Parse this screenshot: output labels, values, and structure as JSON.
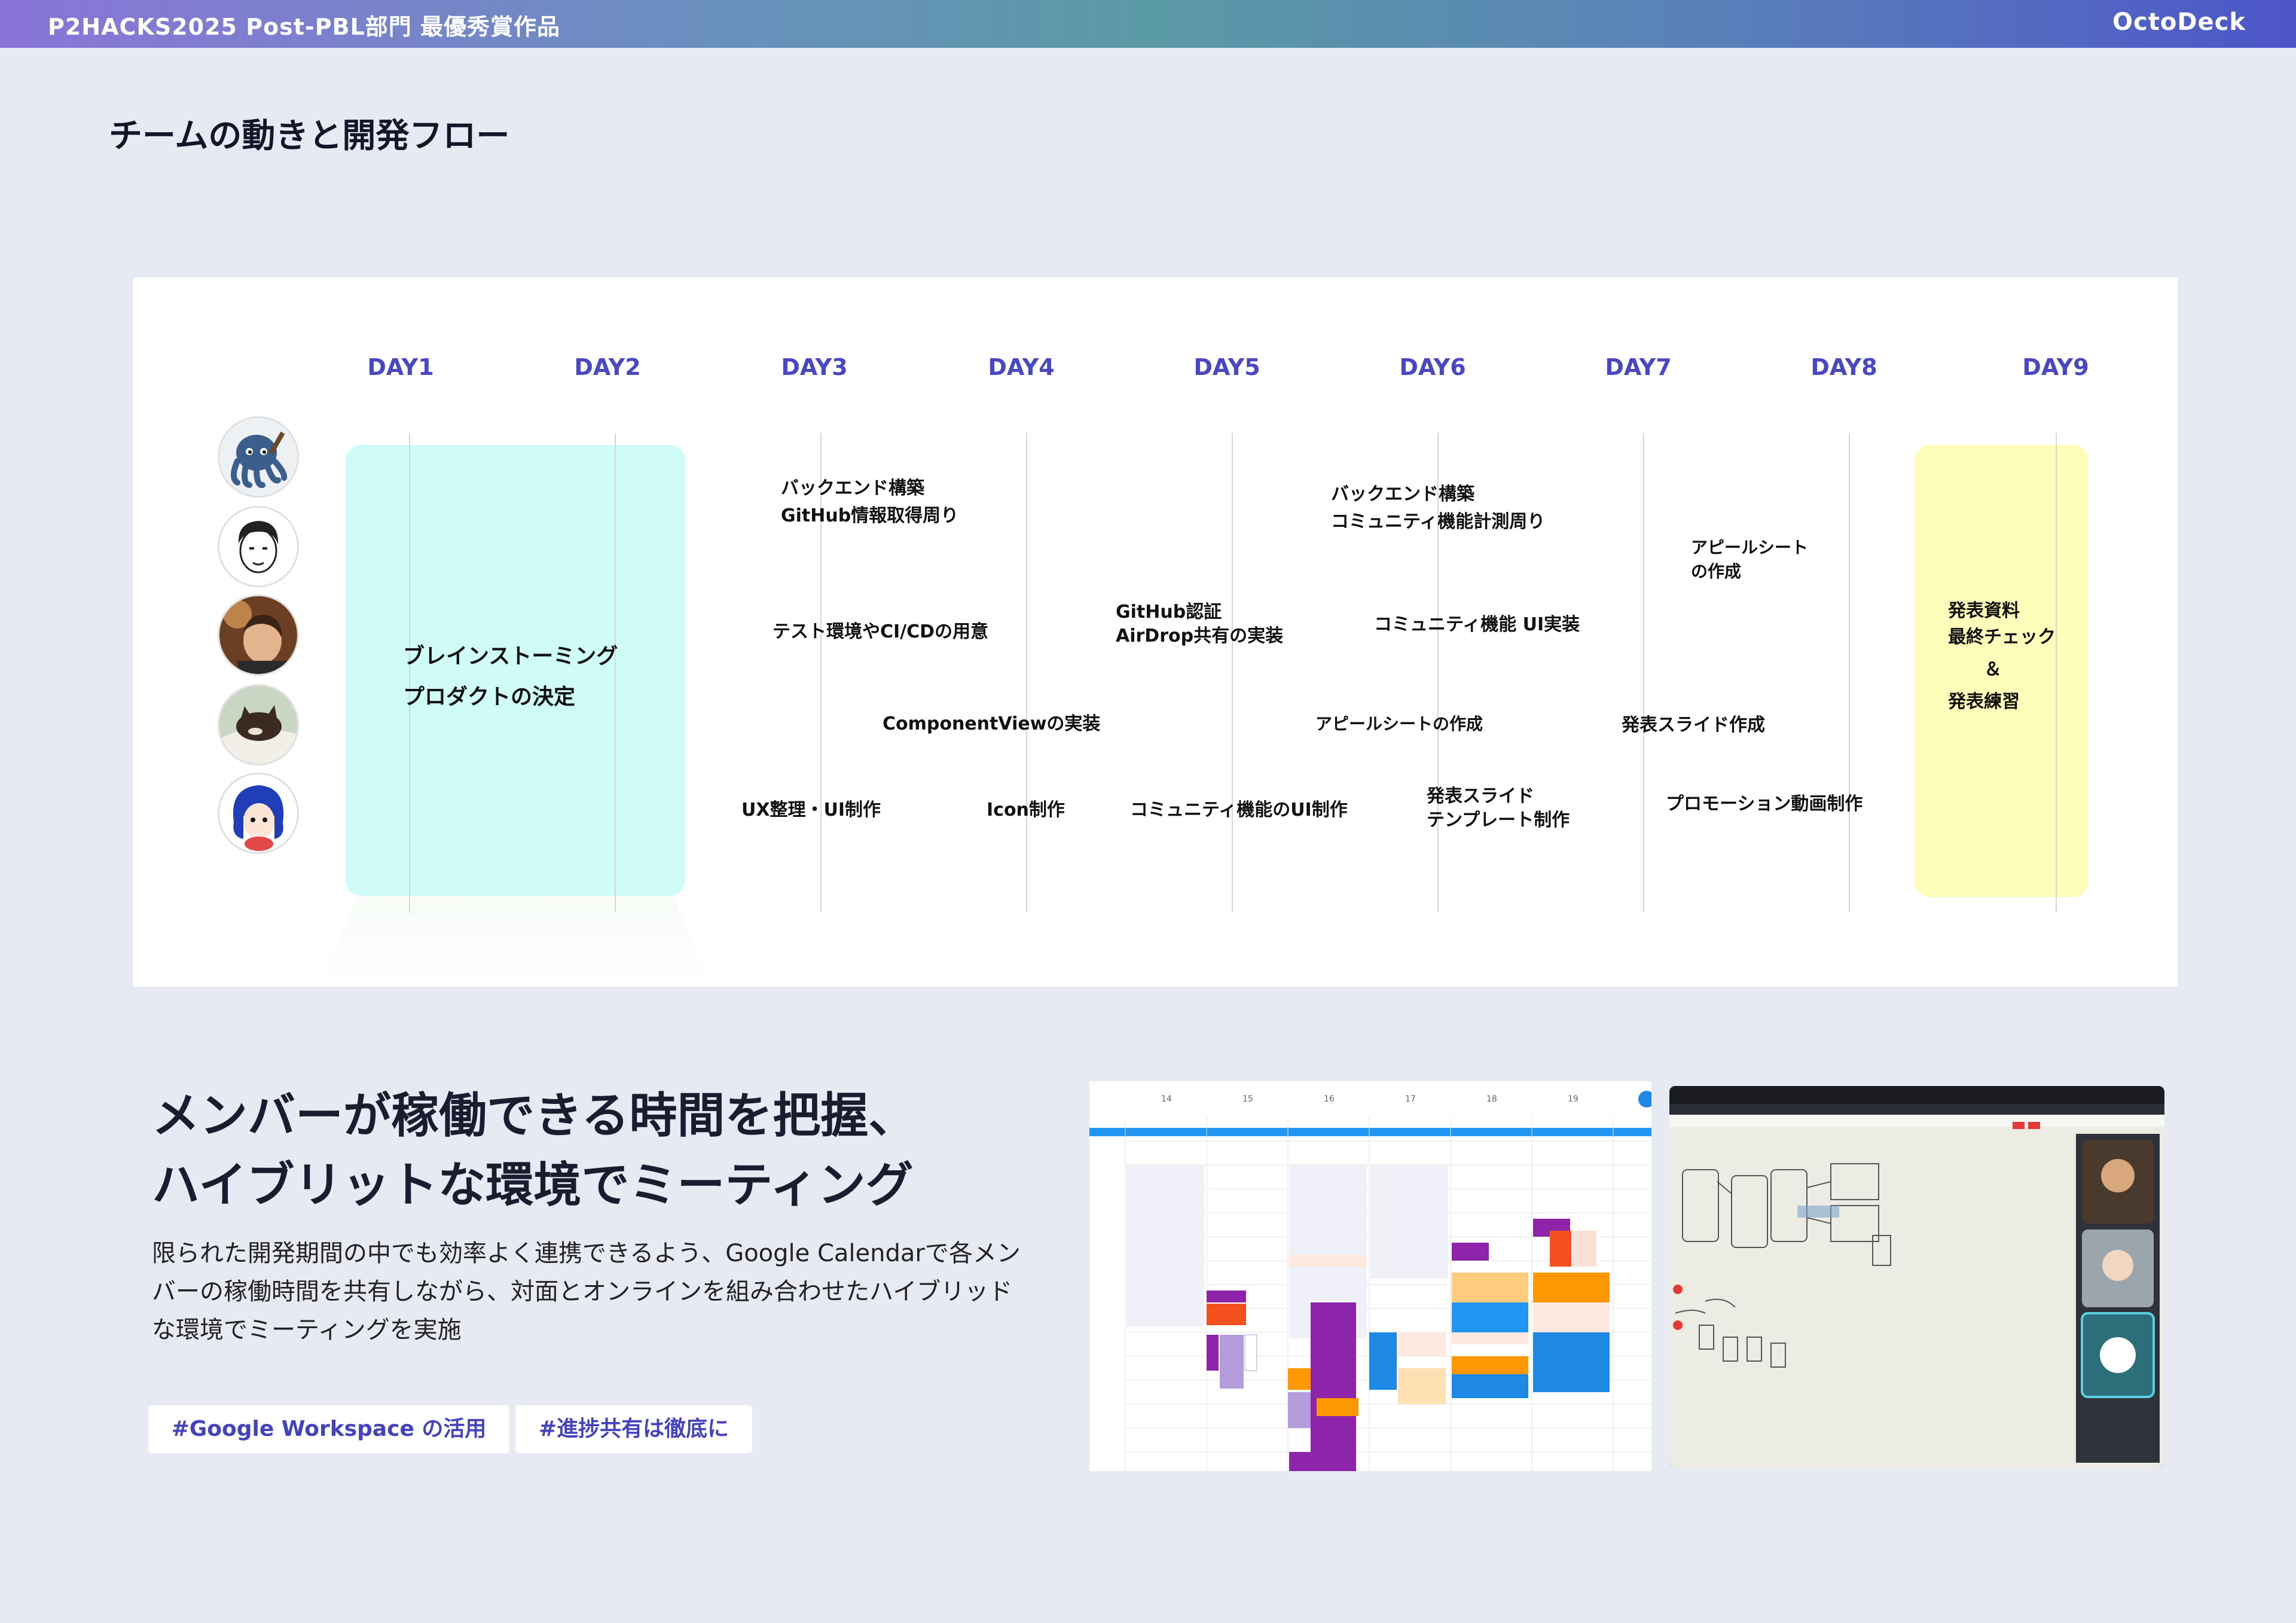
{
  "header": {
    "event_title": "P2HACKS2025 Post-PBL部門 最優秀賞作品",
    "product_name": "OctoDeck"
  },
  "page_title": "チームの動きと開発フロー",
  "timeline": {
    "days": [
      "DAY1",
      "DAY2",
      "DAY3",
      "DAY4",
      "DAY5",
      "DAY6",
      "DAY7",
      "DAY8",
      "DAY9"
    ],
    "phase_start": {
      "lines": [
        "ブレインストーミング",
        "プロダクトの決定"
      ]
    },
    "phase_end": {
      "lines": [
        "発表資料",
        "最終チェック",
        "＆",
        "発表練習"
      ]
    },
    "tasks": [
      {
        "lines": [
          "バックエンド構築",
          "GitHub情報取得周り"
        ]
      },
      {
        "lines": [
          "テスト環境やCI/CDの用意"
        ]
      },
      {
        "lines": [
          "ComponentViewの実装"
        ]
      },
      {
        "lines": [
          "UX整理・UI制作"
        ]
      },
      {
        "lines": [
          "Icon制作"
        ]
      },
      {
        "lines": [
          "GitHub認証",
          "AirDrop共有の実装"
        ]
      },
      {
        "lines": [
          "コミュニティ機能のUI制作"
        ]
      },
      {
        "lines": [
          "バックエンド構築",
          "コミュニティ機能計測周り"
        ]
      },
      {
        "lines": [
          "コミュニティ機能 UI実装"
        ]
      },
      {
        "lines": [
          "アピールシートの作成"
        ]
      },
      {
        "lines": [
          "発表スライド",
          "テンプレート制作"
        ]
      },
      {
        "lines": [
          "アピールシート",
          "の作成"
        ]
      },
      {
        "lines": [
          "発表スライド作成"
        ]
      },
      {
        "lines": [
          "プロモーション動画制作"
        ]
      }
    ]
  },
  "meeting": {
    "headline_lines": [
      "メンバーが稼働できる時間を把握、",
      "ハイブリットな環境でミーティング"
    ],
    "description": "限られた開発期間の中でも効率よく連携できるよう、Google Calendarで各メンバーの稼働時間を共有しながら、対面とオンラインを組み合わせたハイブリッドな環境でミーティングを実施",
    "tags": [
      "#Google Workspace の活用",
      "#進捗共有は徹底に"
    ]
  },
  "calendar_screenshot": {
    "dates": [
      "14",
      "15",
      "16",
      "17",
      "18",
      "19"
    ]
  }
}
